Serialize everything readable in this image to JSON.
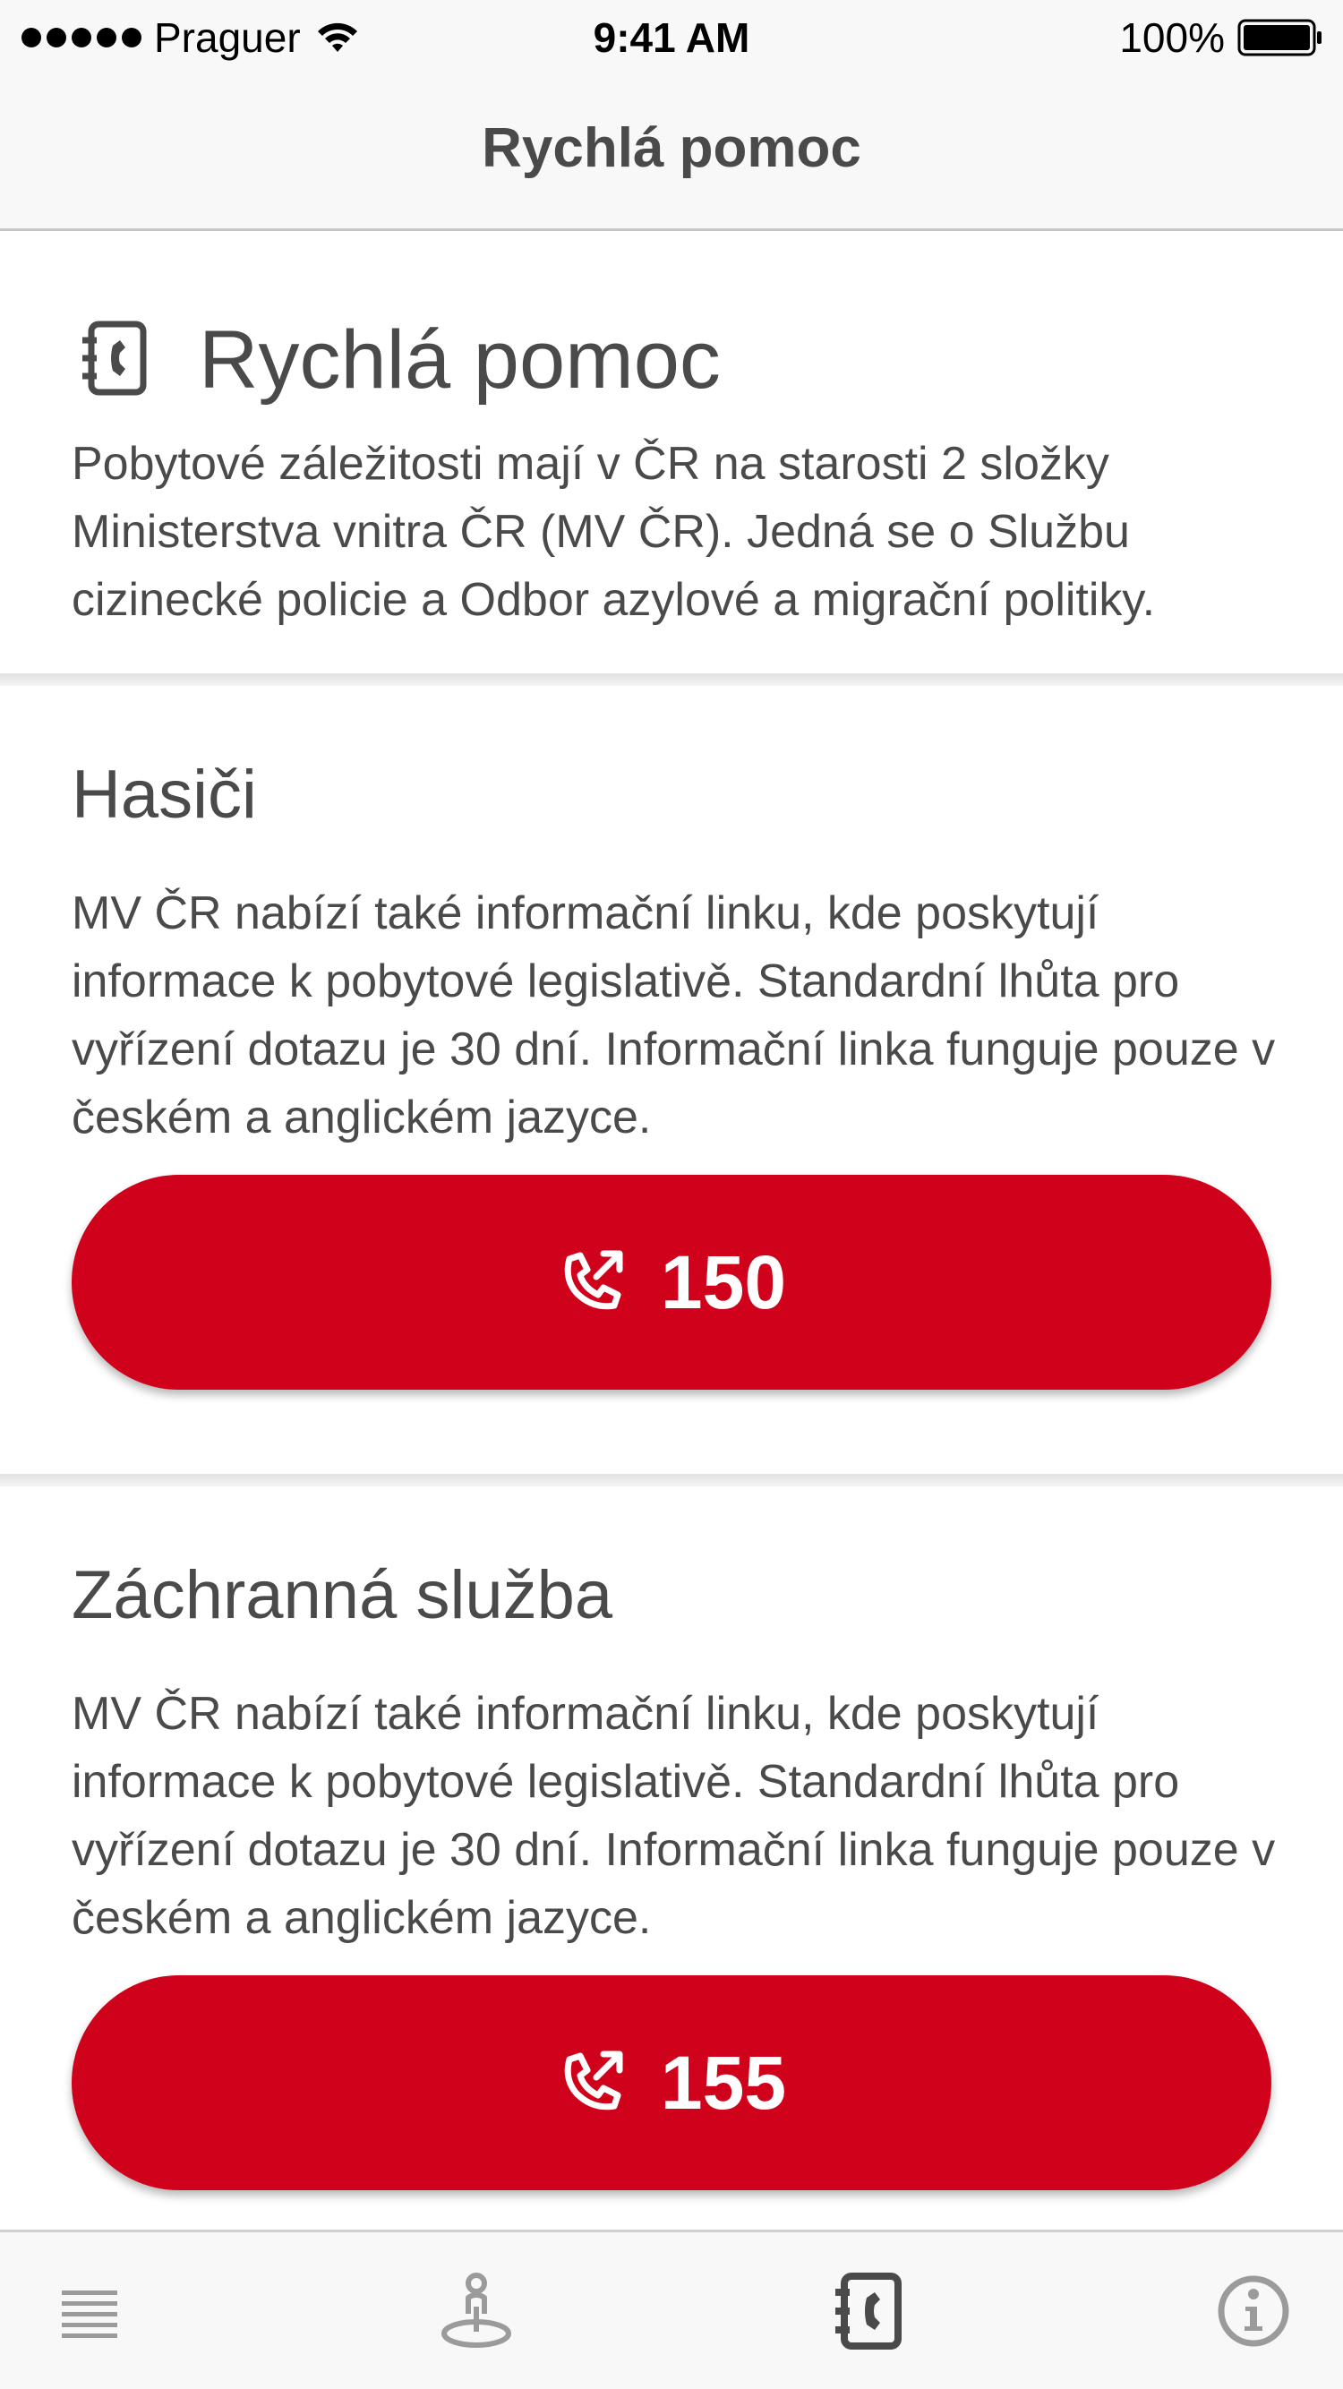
{
  "status_bar": {
    "carrier": "Praguer",
    "time": "9:41 AM",
    "battery": "100%"
  },
  "nav": {
    "title": "Rychlá pomoc"
  },
  "intro": {
    "icon": "phonebook-icon",
    "title": "Rychlá pomoc",
    "text": "Pobytové záležitosti mají v ČR na starosti 2 složky Ministerstva vnitra ČR (MV ČR). Jedná se o Službu cizinecké policie a Odbor azylové a migrační politiky."
  },
  "sections": [
    {
      "title": "Hasiči",
      "text": "MV ČR nabízí také informační linku, kde poskytují informace k pobytové legislativě. Standardní lhůta pro vyřízení dotazu je 30 dní. Informační linka funguje pouze v českém a anglickém jazyce.",
      "number": "150"
    },
    {
      "title": "Záchranná služba",
      "text": "MV ČR nabízí také informační linku, kde poskytují informace k pobytové legislativě. Standardní lhůta pro vyřízení dotazu je 30 dní. Informační linka funguje pouze v českém a anglickém jazyce.",
      "number": "155"
    }
  ],
  "tab_bar": {
    "tabs": [
      {
        "icon": "menu-list-icon",
        "active": false
      },
      {
        "icon": "location-person-icon",
        "active": false
      },
      {
        "icon": "phonebook-icon",
        "active": true
      },
      {
        "icon": "info-icon",
        "active": false
      }
    ]
  },
  "colors": {
    "accent": "#d0021b",
    "text": "#4a4a4a",
    "bar_background": "#f8f8f8",
    "inactive_icon": "#9b9b9b",
    "active_icon": "#4a4a4a"
  }
}
